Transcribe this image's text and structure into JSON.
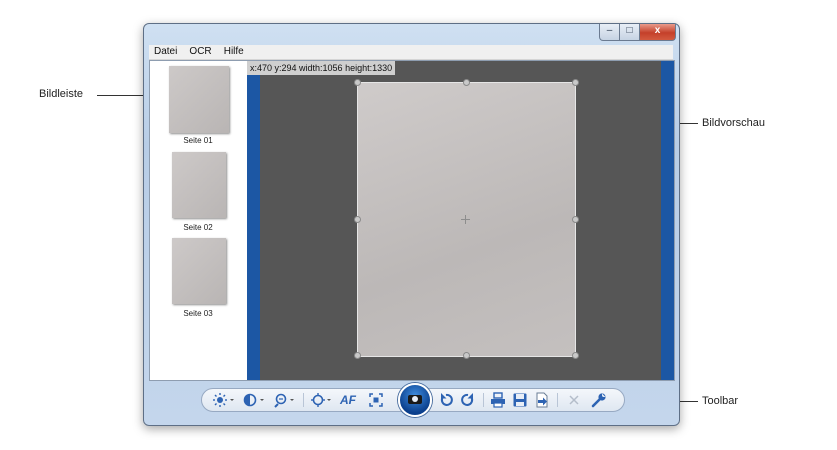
{
  "callouts": {
    "thumbnails": "Bildleiste",
    "preview": "Bildvorschau",
    "toolbar": "Toolbar"
  },
  "window": {
    "controls": {
      "minimize_glyph": "–",
      "maximize_glyph": "□",
      "close_glyph": "x"
    }
  },
  "menu": {
    "items": [
      "Datei",
      "OCR",
      "Hilfe"
    ]
  },
  "thumbnails": [
    {
      "label": "Seite 01",
      "selected": true
    },
    {
      "label": "Seite 02",
      "selected": false
    },
    {
      "label": "Seite 03",
      "selected": false
    }
  ],
  "preview": {
    "coordinates": "x:470 y:294 width:1056 height:1330"
  },
  "toolbar": {
    "af_label": "AF",
    "buttons": [
      "brightness-icon",
      "contrast-icon",
      "zoom-icon",
      "focus-icon",
      "autofocus-icon",
      "fit-icon",
      "camera-capture-icon",
      "rotate-left-icon",
      "rotate-right-icon",
      "print-icon",
      "save-icon",
      "export-icon",
      "delete-icon",
      "settings-icon"
    ]
  },
  "colors": {
    "accent_blue": "#1c57a4",
    "preview_bg": "#565656",
    "close_red": "#c4402a"
  }
}
